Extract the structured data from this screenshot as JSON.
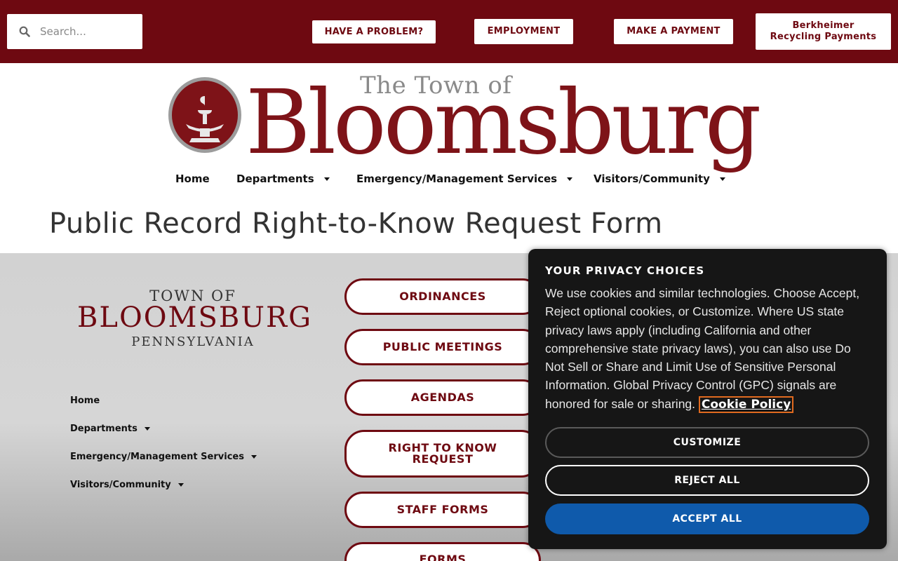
{
  "topbar": {
    "search_placeholder": "Search...",
    "buttons": {
      "problem": "HAVE A PROBLEM?",
      "employment": "EMPLOYMENT",
      "payment": "MAKE A PAYMENT",
      "berkheimer_line1": "Berkheimer",
      "berkheimer_line2": "Recycling Payments"
    }
  },
  "logo": {
    "small": "The Town of",
    "big": "Bloomsburg"
  },
  "nav": {
    "home": "Home",
    "departments": "Departments",
    "emergency": "Emergency/Management Services",
    "visitors": "Visitors/Community"
  },
  "page_title": "Public Record Right-to-Know Request Form",
  "town_logo": {
    "of": "TOWN OF",
    "name": "BLOOMSBURG",
    "state": "PENNSYLVANIA"
  },
  "sidebar": {
    "home": "Home",
    "departments": "Departments",
    "emergency": "Emergency/Management Services",
    "visitors": "Visitors/Community"
  },
  "pills": {
    "ordinances": "ORDINANCES",
    "public_meetings": "PUBLIC MEETINGS",
    "agendas": "AGENDAS",
    "rtk_line1": "RIGHT TO KNOW",
    "rtk_line2": "REQUEST",
    "staff_forms": "STAFF FORMS",
    "forms": "FORMS"
  },
  "cookie": {
    "title": "YOUR PRIVACY CHOICES",
    "text": "We use cookies and similar technologies. Choose Accept, Reject optional cookies, or Customize. Where US state privacy laws apply (including California and other comprehensive state privacy laws), you can also use Do Not Sell or Share and Limit Use of Sensitive Personal Information. Global Privacy Control (GPC) signals are honored for sale or sharing.",
    "link": "Cookie Policy",
    "customize": "CUSTOMIZE",
    "reject": "REJECT ALL",
    "accept": "ACCEPT ALL"
  },
  "colors": {
    "brand_maroon": "#6e0911",
    "accept_blue": "#0f5aab",
    "dialog_bg": "#161616"
  }
}
